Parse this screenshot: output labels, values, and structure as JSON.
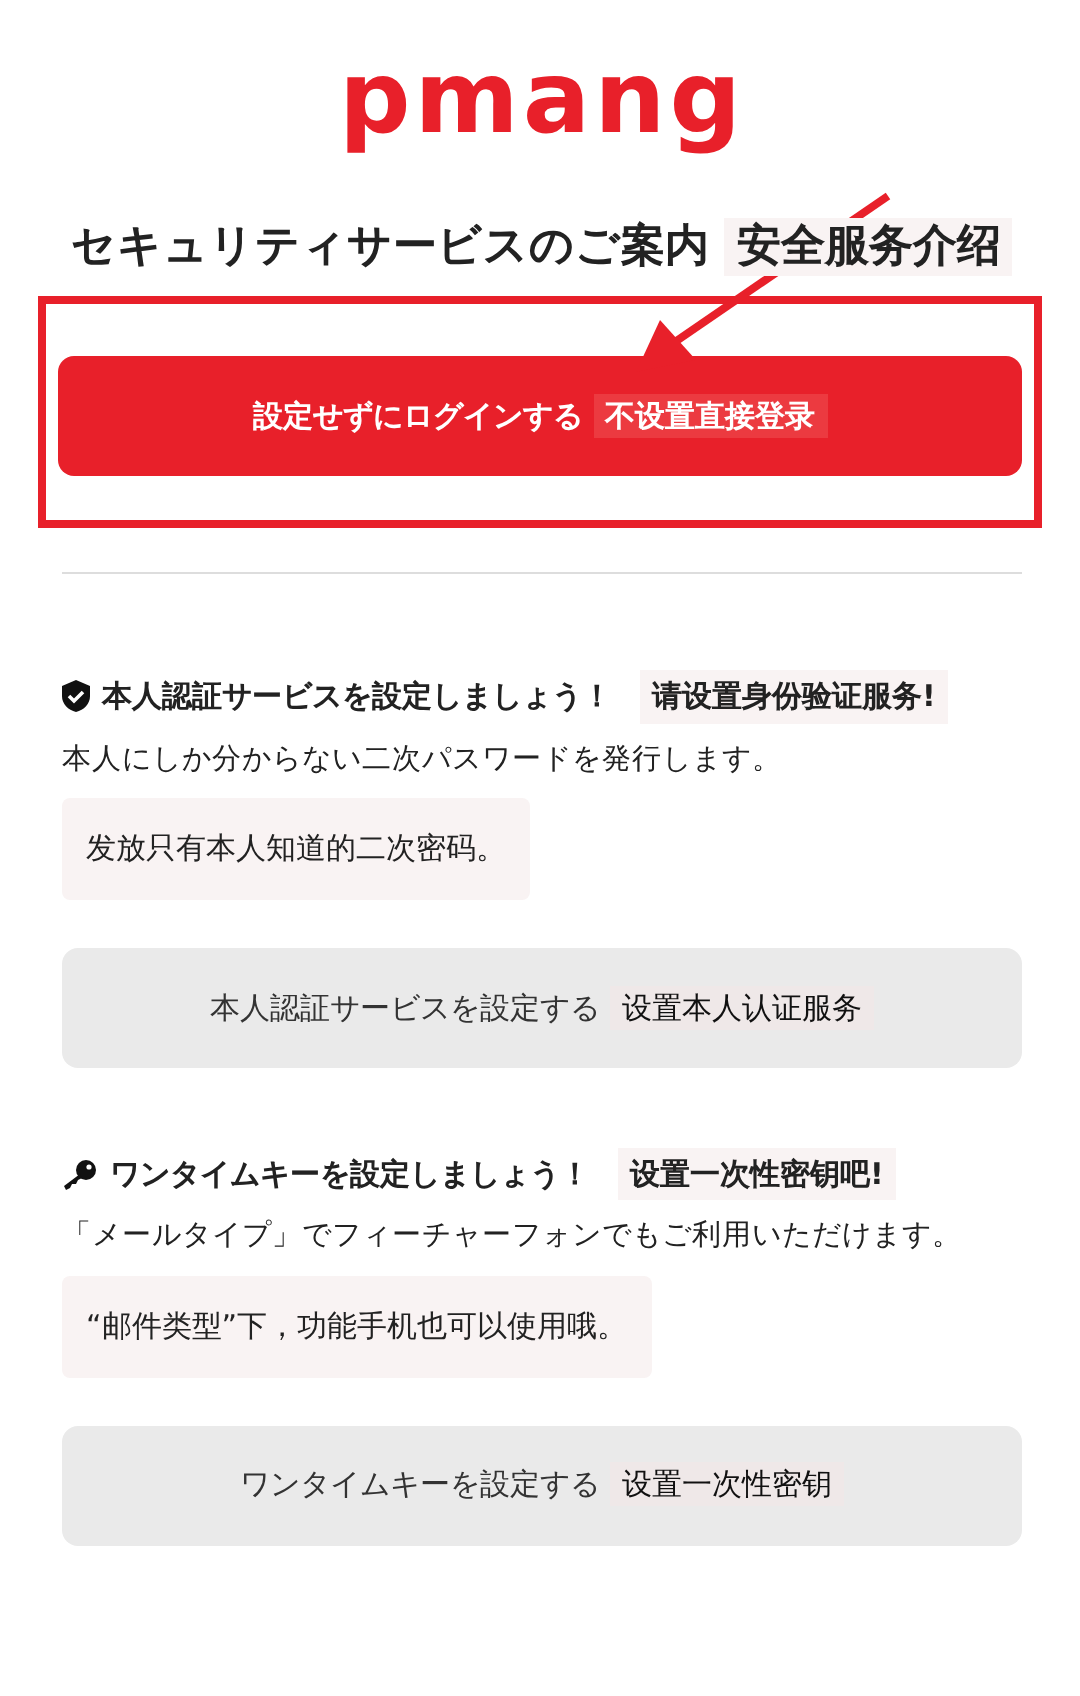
{
  "logo": {
    "text": "pmang"
  },
  "title": {
    "text": "セキュリティサービスのご案内",
    "translation": "安全服务介绍"
  },
  "login_button": {
    "label": "設定せずにログインする",
    "translation": "不设置直接登录"
  },
  "annotation": {
    "highlight_box": true,
    "arrow": true
  },
  "sections": [
    {
      "kind": "shield",
      "heading": "本人認証サービスを設定しましょう！",
      "heading_translation": "请设置身份验证服务!",
      "description": "本人にしか分からない二次パスワードを発行します。",
      "description_translation": "发放只有本人知道的二次密码。",
      "button": {
        "label": "本人認証サービスを設定する",
        "translation": "设置本人认证服务"
      }
    },
    {
      "kind": "key",
      "heading": "ワンタイムキーを設定しましょう！",
      "heading_translation": "设置一次性密钥吧!",
      "description": "「メールタイプ」でフィーチャーフォンでもご利用いただけます。",
      "description_translation": "“邮件类型”下，功能手机也可以使用哦。",
      "button": {
        "label": "ワンタイムキーを設定する",
        "translation": "设置一次性密钥"
      }
    }
  ]
}
